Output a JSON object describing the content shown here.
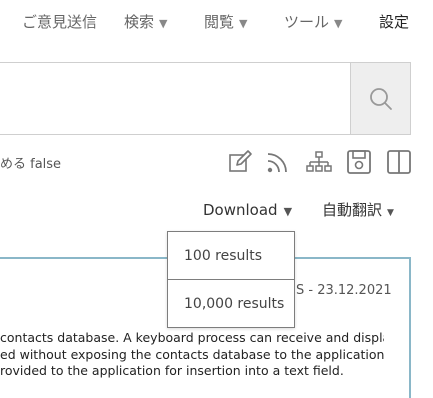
{
  "nav": {
    "feedback": "ご意見送信",
    "search": "検索",
    "browse": "閲覧",
    "tools": "ツール",
    "settings": "設定"
  },
  "search": {
    "value": "",
    "placeholder": ""
  },
  "query_info": "める false",
  "toolbar": {
    "icons": [
      "edit-icon",
      "rss-icon",
      "sitemap-icon",
      "save-icon",
      "split-view-icon"
    ]
  },
  "download": {
    "label": "Download",
    "options": [
      "100 results",
      "10,000 results"
    ]
  },
  "translate": {
    "label": "自動翻訳"
  },
  "result": {
    "meta": "S - 23.12.2021",
    "abstract_lines": [
      "contacts database. A keyboard process can receive and display",
      "ed without exposing the contacts database to the application.",
      "rovided to the application for insertion into a text field."
    ]
  },
  "colors": {
    "card_border": "#8ab7c8",
    "search_button_bg": "#eeeeee",
    "icon_gray": "#777777"
  }
}
